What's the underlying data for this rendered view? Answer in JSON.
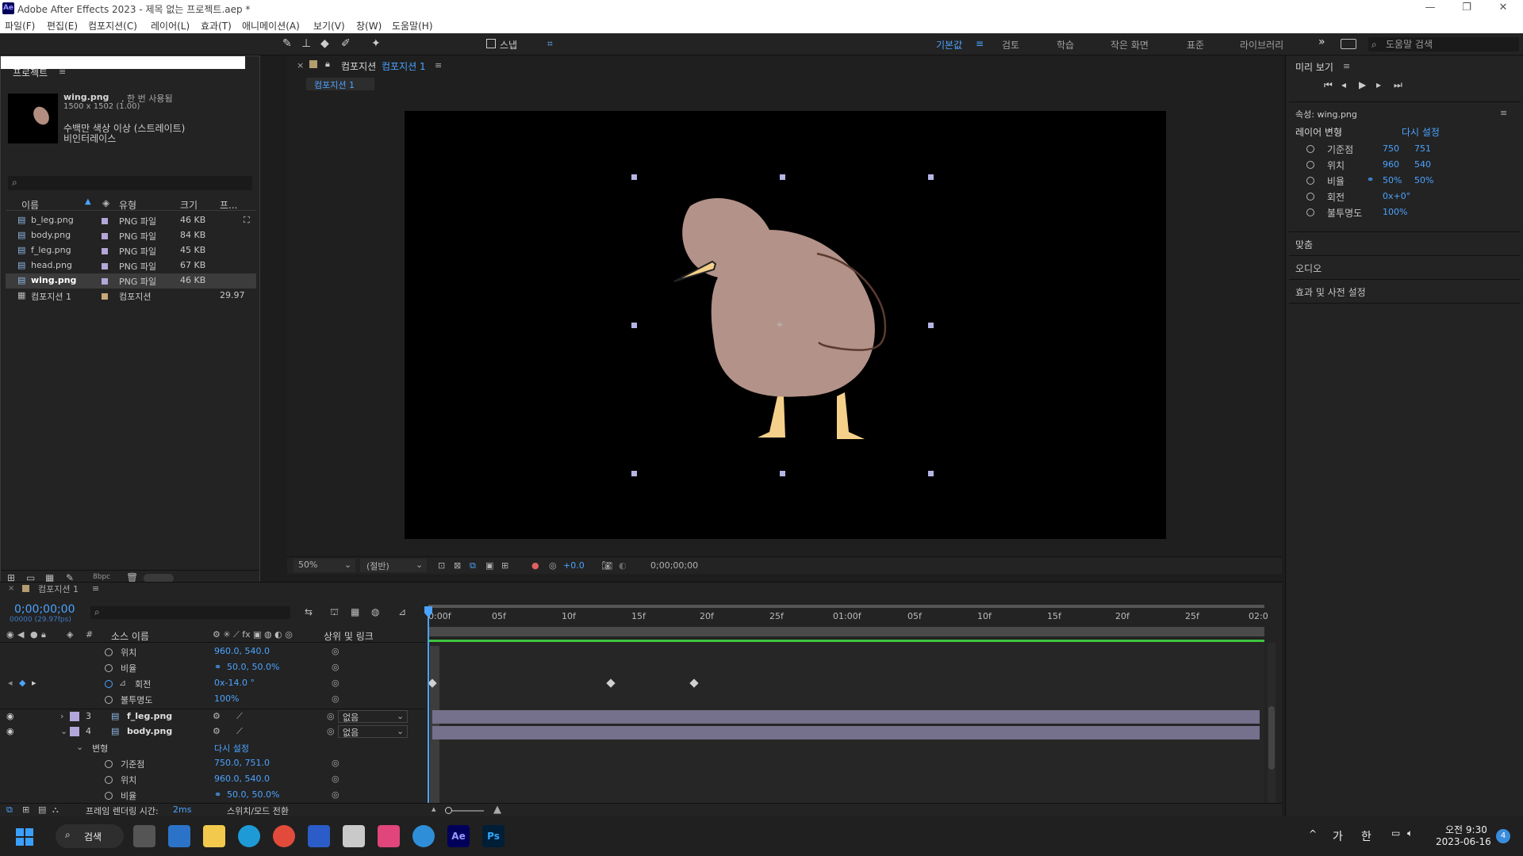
{
  "titlebar": {
    "app_icon": "Ae",
    "title": "Adobe After Effects 2023 - 제목 없는 프로젝트.aep *",
    "controls": [
      "minimize-icon",
      "restore-icon",
      "close-icon"
    ]
  },
  "menubar": {
    "items": [
      "파일(F)",
      "편집(E)",
      "컴포지션(C)",
      "레이어(L)",
      "효과(T)",
      "애니메이션(A)",
      "보기(V)",
      "창(W)",
      "도움말(H)"
    ]
  },
  "toolbar": {
    "snap_label": "스냅",
    "workspaces": [
      "기본값",
      "검토",
      "학습",
      "작은 화면",
      "표준",
      "라이브러리"
    ],
    "active_workspace": "기본값",
    "more": "»",
    "help_search_placeholder": "도움말 검색"
  },
  "project": {
    "title": "프로젝트",
    "selected_name": "wing.png",
    "usage": ", 한 번 사용됨",
    "dimensions": "1500 x 1502 (1.00)",
    "color_info": "수백만 색상 이상 (스트레이트)",
    "interlace": "비인터레이스",
    "columns": [
      "이름",
      "유형",
      "크기",
      "프..."
    ],
    "files": [
      {
        "name": "b_leg.png",
        "type": "PNG 파일",
        "size": "46 KB",
        "fps": ""
      },
      {
        "name": "body.png",
        "type": "PNG 파일",
        "size": "84 KB",
        "fps": ""
      },
      {
        "name": "f_leg.png",
        "type": "PNG 파일",
        "size": "45 KB",
        "fps": ""
      },
      {
        "name": "head.png",
        "type": "PNG 파일",
        "size": "67 KB",
        "fps": ""
      },
      {
        "name": "wing.png",
        "type": "PNG 파일",
        "size": "46 KB",
        "fps": ""
      },
      {
        "name": "컴포지션 1",
        "type": "컴포지션",
        "size": "",
        "fps": "29.97"
      }
    ],
    "bpc": "8bpc"
  },
  "composition": {
    "tab_prefix": "컴포지션",
    "tab_name": "컴포지션 1",
    "subtab": "컴포지션 1",
    "zoom": "50%",
    "resolution": "(절반)",
    "exposure": "+0.0",
    "timecode": "0;00;00;00"
  },
  "right_panel": {
    "preview_title": "미리 보기",
    "props_title": "속성: wing.png",
    "transform_label": "레이어 변형",
    "reset_label": "다시 설정",
    "props": [
      {
        "name": "기준점",
        "v1": "750",
        "v2": "751"
      },
      {
        "name": "위치",
        "v1": "960",
        "v2": "540"
      },
      {
        "name": "비율",
        "v1": "50%",
        "v2": "50%"
      },
      {
        "name": "회전",
        "v1": "0x+0°",
        "v2": ""
      },
      {
        "name": "불투명도",
        "v1": "100%",
        "v2": ""
      }
    ],
    "sections": [
      "맞춤",
      "오디오",
      "효과 및 사전 설정"
    ]
  },
  "timeline": {
    "tab": "컴포지션 1",
    "timecode": "0;00;00;00",
    "fps": "00000 (29.97fps)",
    "col_source": "소스 이름",
    "col_parent": "상위 및 링크",
    "ruler": [
      "0:00f",
      "05f",
      "10f",
      "15f",
      "20f",
      "25f",
      "01:00f",
      "05f",
      "10f",
      "15f",
      "20f",
      "25f",
      "02:0"
    ],
    "rows": [
      {
        "label": "위치",
        "value": "960.0, 540.0",
        "kind": "prop"
      },
      {
        "label": "비율",
        "value": "50.0, 50.0%",
        "kind": "prop"
      },
      {
        "label": "회전",
        "value": "0x-14.0 °",
        "kind": "prop"
      },
      {
        "label": "불투명도",
        "value": "100%",
        "kind": "prop"
      },
      {
        "label": "f_leg.png",
        "num": "3",
        "parent": "없음",
        "kind": "layer"
      },
      {
        "label": "body.png",
        "num": "4",
        "parent": "없음",
        "kind": "layer"
      },
      {
        "label": "변형",
        "value": "다시 설정",
        "kind": "group"
      },
      {
        "label": "기준점",
        "value": "750.0, 751.0",
        "kind": "prop"
      },
      {
        "label": "위치",
        "value": "960.0, 540.0",
        "kind": "prop"
      },
      {
        "label": "비율",
        "value": "50.0, 50.0%",
        "kind": "prop"
      }
    ],
    "render_time_label": "프레임 렌더링 시간:",
    "render_time": "2ms",
    "switch_label": "스위치/모드 전환"
  },
  "taskbar": {
    "search": "검색",
    "ime1": "가",
    "ime2": "한",
    "time": "오전 9:30",
    "date": "2023-06-16",
    "notif": "4"
  }
}
